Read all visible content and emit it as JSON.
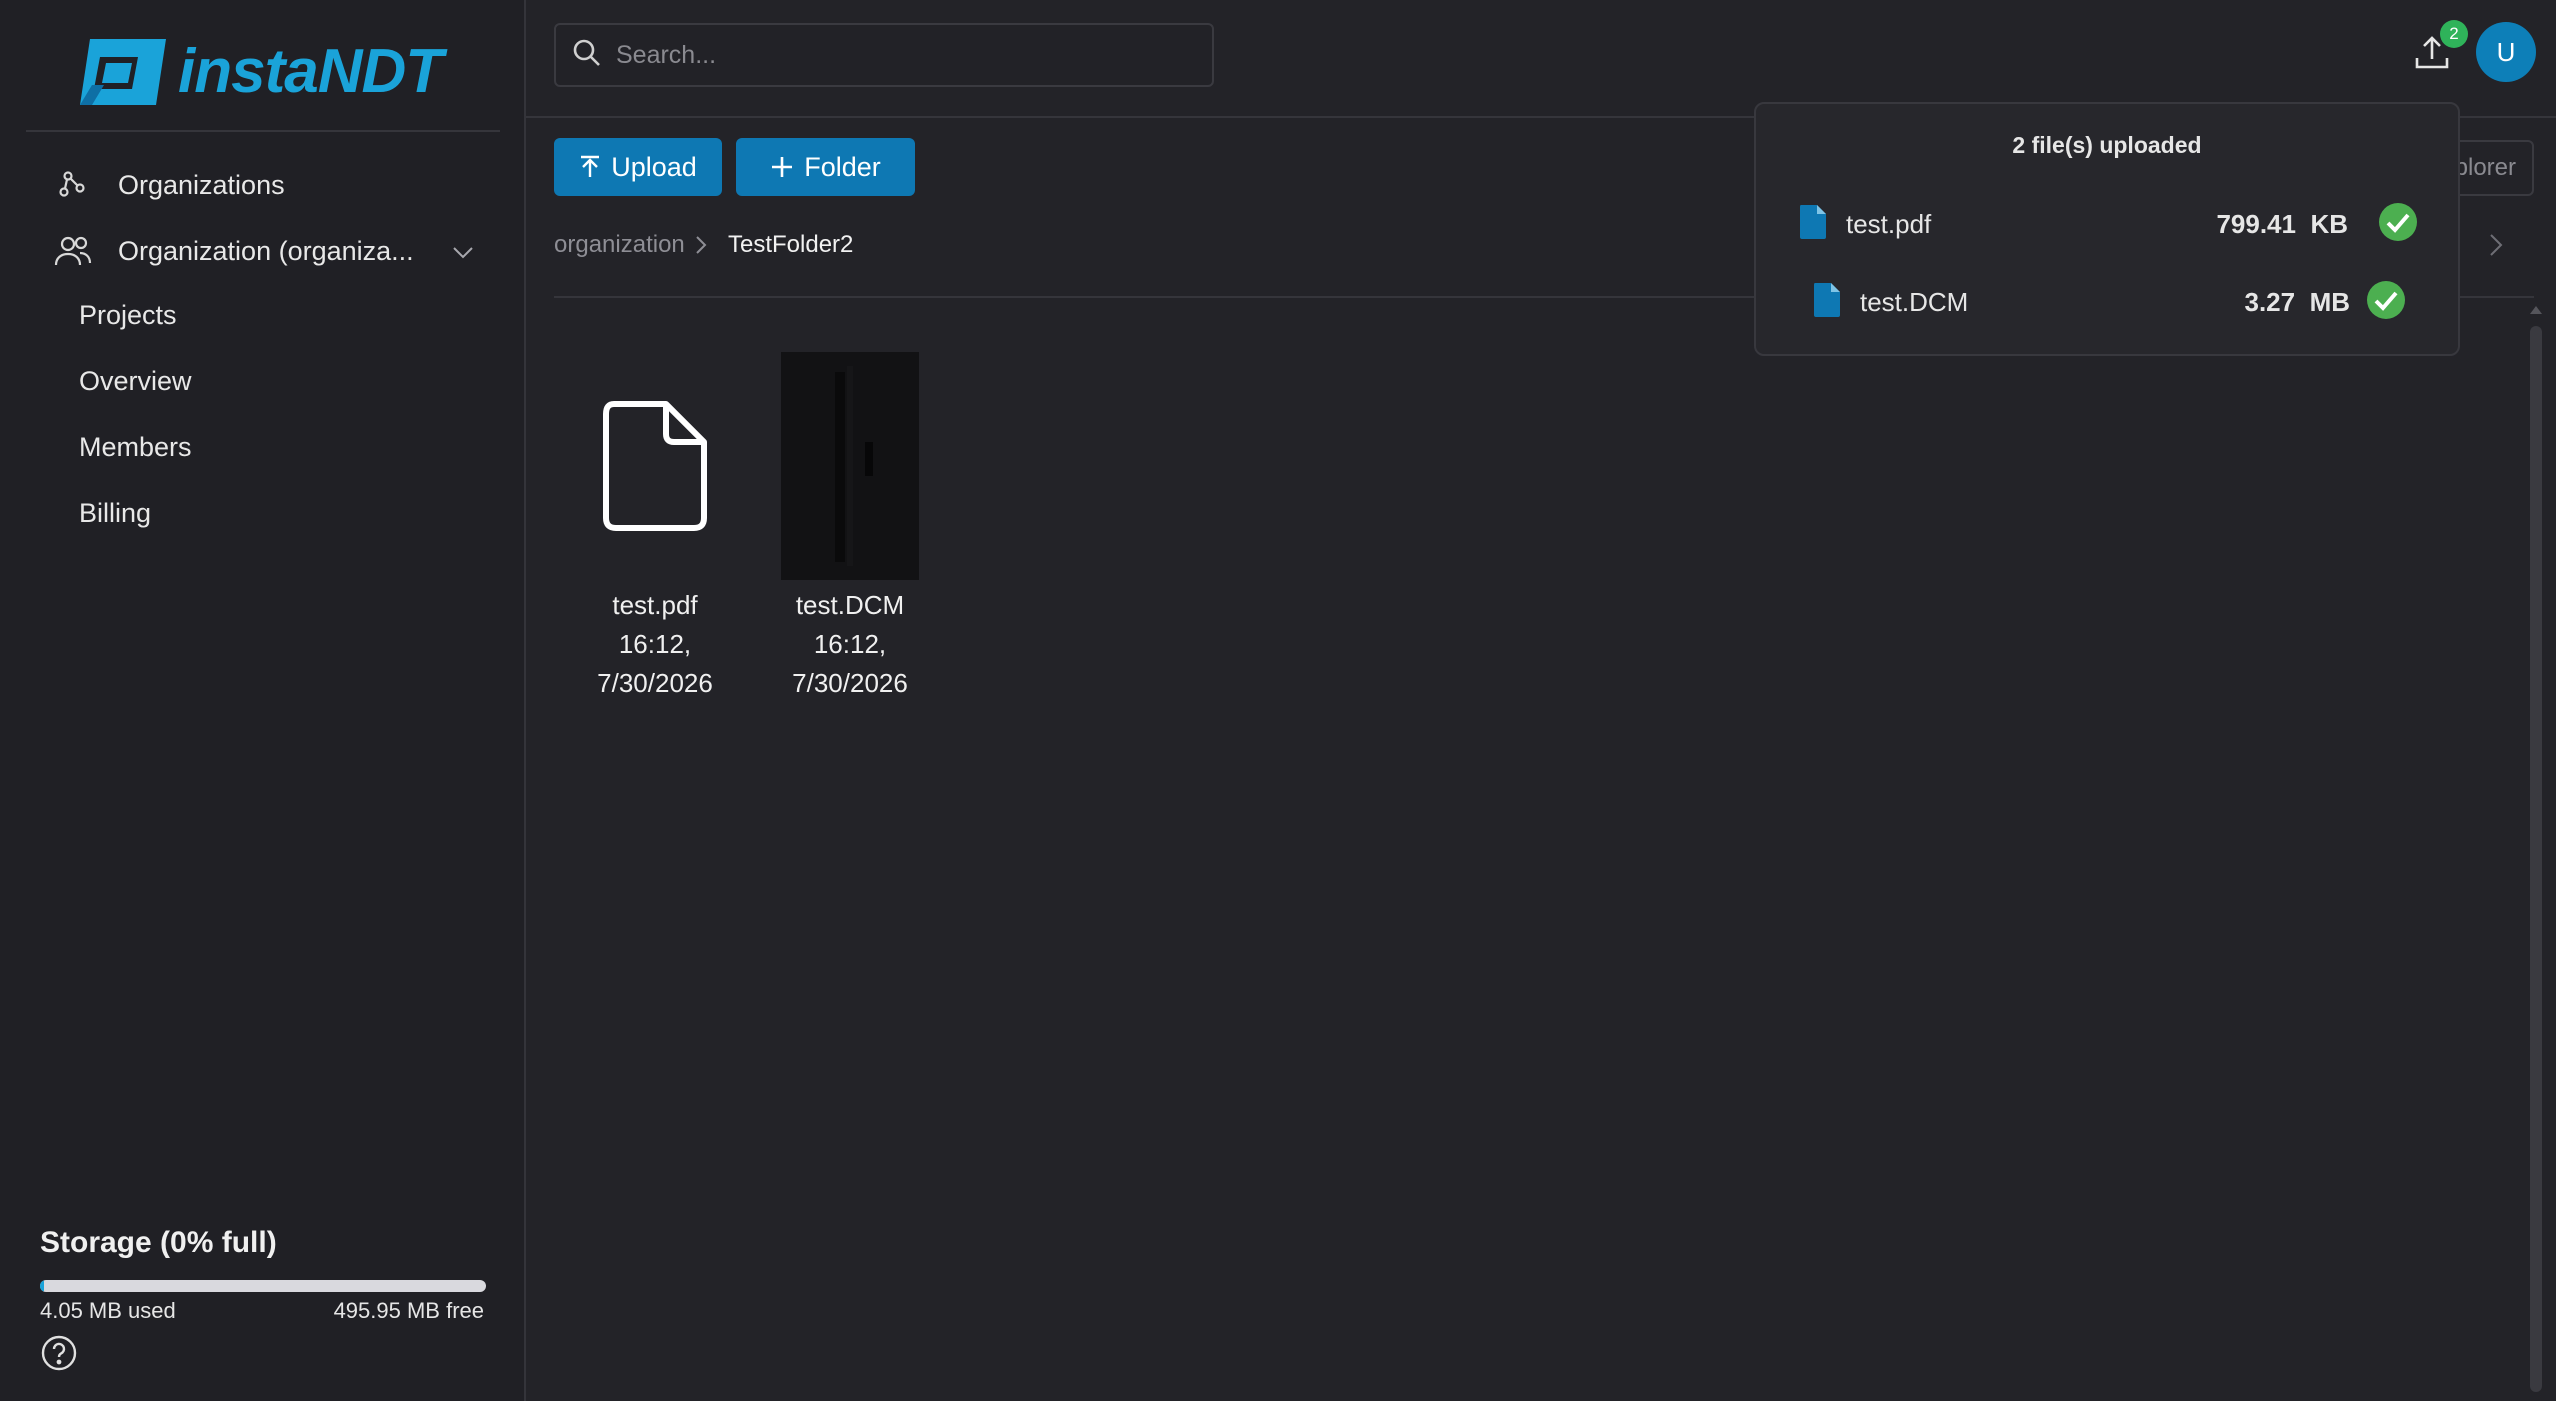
{
  "app": {
    "logo_text": "instaNDT"
  },
  "sidebar": {
    "items": [
      {
        "label": "Organizations",
        "icon": "organizations-icon"
      },
      {
        "label": "Organization (organiza...",
        "icon": "users-icon"
      },
      {
        "label": "Projects"
      },
      {
        "label": "Overview"
      },
      {
        "label": "Members"
      },
      {
        "label": "Billing"
      }
    ]
  },
  "storage": {
    "title": "Storage (0% full)",
    "used": "4.05 MB used",
    "free": "495.95 MB free",
    "percent_full": 0
  },
  "header": {
    "search_placeholder": "Search...",
    "upload_badge_count": "2",
    "avatar_initial": "U"
  },
  "toolbar": {
    "upload_label": "Upload",
    "folder_label": "Folder",
    "explorer_label": "plorer"
  },
  "breadcrumb": {
    "root": "organization",
    "current": "TestFolder2"
  },
  "files": [
    {
      "name": "test.pdf",
      "time": "16:12,",
      "date": "7/30/2026",
      "thumb": "file-icon"
    },
    {
      "name": "test.DCM",
      "time": "16:12,",
      "date": "7/30/2026",
      "thumb": "dicom-preview"
    }
  ],
  "upload_popover": {
    "title": "2 file(s) uploaded",
    "items": [
      {
        "name": "test.pdf",
        "size": "799.41",
        "unit": "KB",
        "status": "done"
      },
      {
        "name": "test.DCM",
        "size": "3.27",
        "unit": "MB",
        "status": "done"
      }
    ]
  },
  "colors": {
    "accent": "#0e78b3",
    "brand": "#1aa3d9",
    "success": "#2fb35a",
    "background": "#232328",
    "sidebar": "#202025"
  }
}
